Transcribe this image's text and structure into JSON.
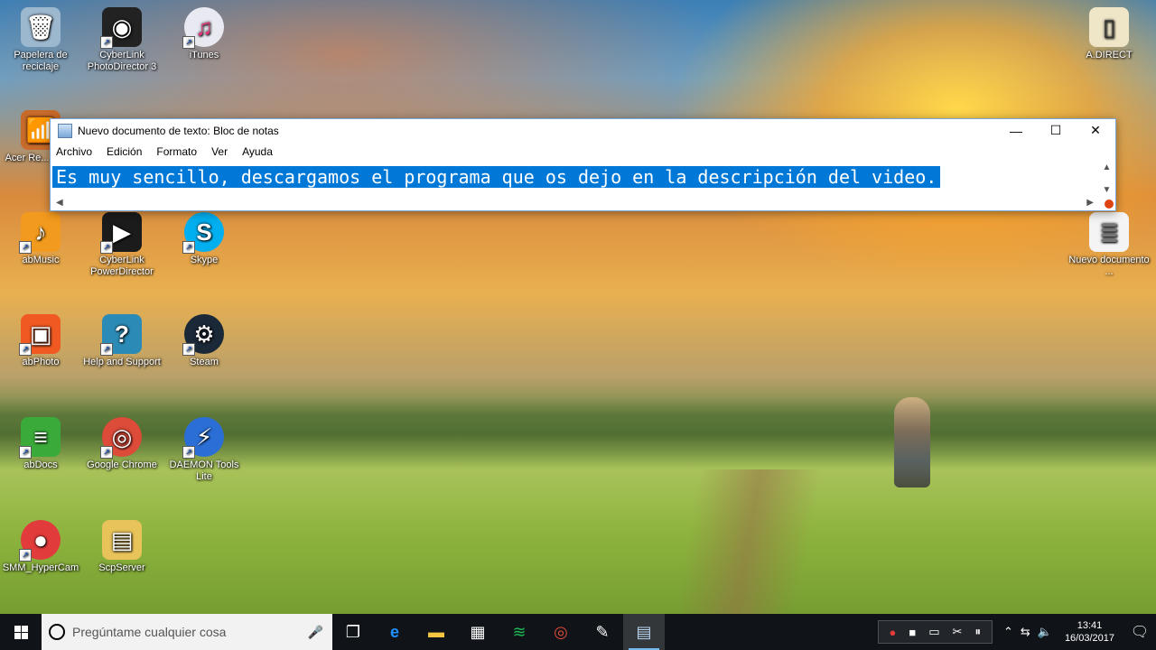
{
  "desktop": {
    "icons": [
      {
        "label": "Papelera de reciclaje",
        "icon": "recycle-bin-icon",
        "glyph": "🗑",
        "color": "#9cb8cf"
      },
      {
        "label": "CyberLink PhotoDirector 3",
        "icon": "photodirector-icon",
        "glyph": "◉",
        "color": "#222222"
      },
      {
        "label": "iTunes",
        "icon": "itunes-icon",
        "glyph": "♫",
        "color": "#e9e9f2"
      },
      {
        "label": "Acer Re... File...",
        "icon": "acer-icon",
        "glyph": "📶",
        "color": "#c76a2a"
      },
      {
        "label": "abMusic",
        "icon": "abmusic-icon",
        "glyph": "♪",
        "color": "#f29a1d"
      },
      {
        "label": "CyberLink PowerDirector",
        "icon": "powerdirector-icon",
        "glyph": "▶",
        "color": "#1b1b1b"
      },
      {
        "label": "Skype",
        "icon": "skype-icon",
        "glyph": "S",
        "color": "#00aff0"
      },
      {
        "label": "abPhoto",
        "icon": "abphoto-icon",
        "glyph": "▣",
        "color": "#f05a22"
      },
      {
        "label": "Help and Support",
        "icon": "help-icon",
        "glyph": "?",
        "color": "#2b8bb6"
      },
      {
        "label": "Steam",
        "icon": "steam-icon",
        "glyph": "⚙",
        "color": "#1b2838"
      },
      {
        "label": "abDocs",
        "icon": "abdocs-icon",
        "glyph": "≡",
        "color": "#3aaa3a"
      },
      {
        "label": "Google Chrome",
        "icon": "chrome-icon",
        "glyph": "◎",
        "color": "#dd4b39"
      },
      {
        "label": "DAEMON Tools Lite",
        "icon": "daemon-tools-icon",
        "glyph": "⚡",
        "color": "#2b6fd6"
      },
      {
        "label": "SMM_HyperCam",
        "icon": "hypercam-icon",
        "glyph": "●",
        "color": "#e23b3b"
      },
      {
        "label": "ScpServer",
        "icon": "folder-icon",
        "glyph": "▤",
        "color": "#e8c35a"
      },
      {
        "label": "A.DIRECT",
        "icon": "file-icon",
        "glyph": "▯",
        "color": "#efe6c8"
      },
      {
        "label": "Nuevo documento ...",
        "icon": "text-document-icon",
        "glyph": "≣",
        "color": "#f4f4f4"
      }
    ]
  },
  "notepad": {
    "title": "Nuevo documento de texto: Bloc de notas",
    "menu": [
      "Archivo",
      "Edición",
      "Formato",
      "Ver",
      "Ayuda"
    ],
    "content": "Es muy sencillo, descargamos el programa que os dejo en la descripción del video.",
    "controls": {
      "minimize": "—",
      "maximize": "☐",
      "close": "✕"
    }
  },
  "taskbar": {
    "search_placeholder": "Pregúntame cualquier cosa",
    "apps": [
      {
        "icon": "task-view-icon",
        "glyph": "❐"
      },
      {
        "icon": "edge-icon",
        "glyph": "e"
      },
      {
        "icon": "file-explorer-icon",
        "glyph": "▬"
      },
      {
        "icon": "store-icon",
        "glyph": "▦"
      },
      {
        "icon": "spotify-icon",
        "glyph": "≋"
      },
      {
        "icon": "chrome-icon",
        "glyph": "◎"
      },
      {
        "icon": "app-icon",
        "glyph": "✎"
      },
      {
        "icon": "notepad-icon",
        "glyph": "▤"
      }
    ],
    "tray": {
      "time": "13:41",
      "date": "16/03/2017"
    }
  },
  "colors": {
    "selection": "#0078d7",
    "taskbar": "#101418"
  }
}
